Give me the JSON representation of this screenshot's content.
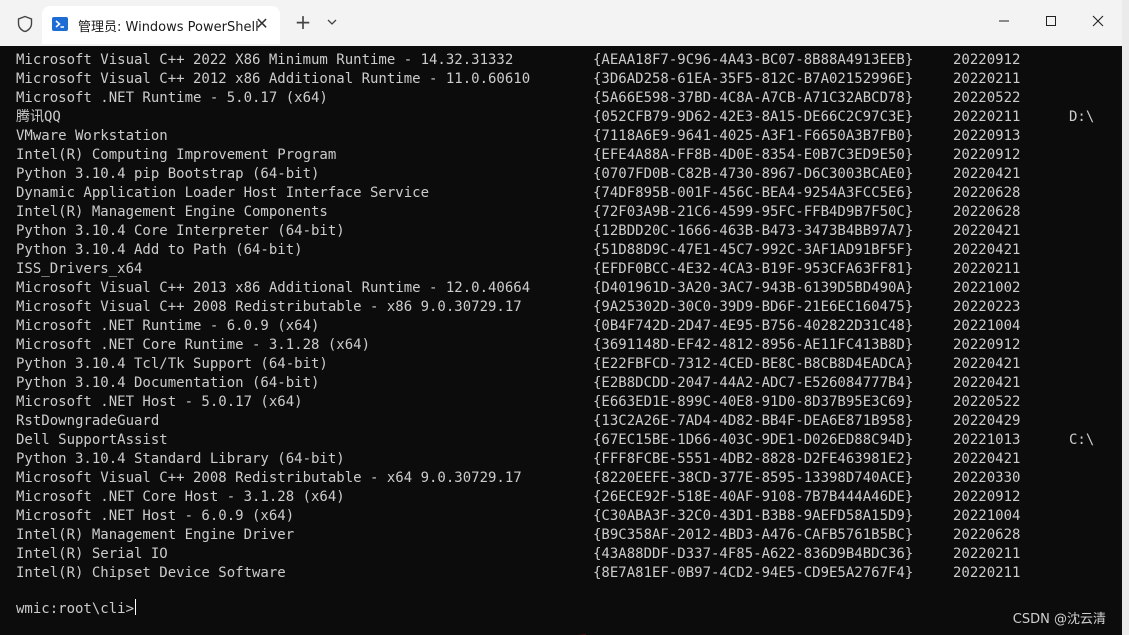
{
  "window": {
    "tab_title": "管理员: Windows PowerShell",
    "close_tab_glyph": "✕",
    "new_tab_glyph": "+",
    "controls": [
      "minimize-icon",
      "maximize-icon",
      "close-icon"
    ]
  },
  "terminal": {
    "rows": [
      {
        "name": "Microsoft Visual C++ 2022 X86 Minimum Runtime - 14.32.31332",
        "guid": "{AEAA18F7-9C96-4A43-BC07-8B88A4913EEB}",
        "date": "20220912",
        "loc": ""
      },
      {
        "name": "Microsoft Visual C++ 2012 x86 Additional Runtime - 11.0.60610",
        "guid": "{3D6AD258-61EA-35F5-812C-B7A02152996E}",
        "date": "20220211",
        "loc": ""
      },
      {
        "name": "Microsoft .NET Runtime - 5.0.17 (x64)",
        "guid": "{5A66E598-37BD-4C8A-A7CB-A71C32ABCD78}",
        "date": "20220522",
        "loc": ""
      },
      {
        "name": "腾讯QQ",
        "guid": "{052CFB79-9D62-42E3-8A15-DE66C2C97C3E}",
        "date": "20220211",
        "loc": "D:\\"
      },
      {
        "name": "VMware Workstation",
        "guid": "{7118A6E9-9641-4025-A3F1-F6650A3B7FB0}",
        "date": "20220913",
        "loc": ""
      },
      {
        "name": "Intel(R) Computing Improvement Program",
        "guid": "{EFE4A88A-FF8B-4D0E-8354-E0B7C3ED9E50}",
        "date": "20220912",
        "loc": ""
      },
      {
        "name": "Python 3.10.4 pip Bootstrap (64-bit)",
        "guid": "{0707FD0B-C82B-4730-8967-D6C3003BCAE0}",
        "date": "20220421",
        "loc": ""
      },
      {
        "name": "Dynamic Application Loader Host Interface Service",
        "guid": "{74DF895B-001F-456C-BEA4-9254A3FCC5E6}",
        "date": "20220628",
        "loc": ""
      },
      {
        "name": "Intel(R) Management Engine Components",
        "guid": "{72F03A9B-21C6-4599-95FC-FFB4D9B7F50C}",
        "date": "20220628",
        "loc": ""
      },
      {
        "name": "Python 3.10.4 Core Interpreter (64-bit)",
        "guid": "{12BDD20C-1666-463B-B473-3473B4BB97A7}",
        "date": "20220421",
        "loc": ""
      },
      {
        "name": "Python 3.10.4 Add to Path (64-bit)",
        "guid": "{51D88D9C-47E1-45C7-992C-3AF1AD91BF5F}",
        "date": "20220421",
        "loc": ""
      },
      {
        "name": "ISS_Drivers_x64",
        "guid": "{EFDF0BCC-4E32-4CA3-B19F-953CFA63FF81}",
        "date": "20220211",
        "loc": ""
      },
      {
        "name": "Microsoft Visual C++ 2013 x86 Additional Runtime - 12.0.40664",
        "guid": "{D401961D-3A20-3AC7-943B-6139D5BD490A}",
        "date": "20221002",
        "loc": ""
      },
      {
        "name": "Microsoft Visual C++ 2008 Redistributable - x86 9.0.30729.17",
        "guid": "{9A25302D-30C0-39D9-BD6F-21E6EC160475}",
        "date": "20220223",
        "loc": ""
      },
      {
        "name": "Microsoft .NET Runtime - 6.0.9 (x64)",
        "guid": "{0B4F742D-2D47-4E95-B756-402822D31C48}",
        "date": "20221004",
        "loc": ""
      },
      {
        "name": "Microsoft .NET Core Runtime - 3.1.28 (x64)",
        "guid": "{3691148D-EF42-4812-8956-AE11FC413B8D}",
        "date": "20220912",
        "loc": ""
      },
      {
        "name": "Python 3.10.4 Tcl/Tk Support (64-bit)",
        "guid": "{E22FBFCD-7312-4CED-BE8C-B8CB8D4EADCA}",
        "date": "20220421",
        "loc": ""
      },
      {
        "name": "Python 3.10.4 Documentation (64-bit)",
        "guid": "{E2B8DCDD-2047-44A2-ADC7-E526084777B4}",
        "date": "20220421",
        "loc": ""
      },
      {
        "name": "Microsoft .NET Host - 5.0.17 (x64)",
        "guid": "{E663ED1E-899C-40E8-91D0-8D37B95E3C69}",
        "date": "20220522",
        "loc": ""
      },
      {
        "name": "RstDowngradeGuard",
        "guid": "{13C2A26E-7AD4-4D82-BB4F-DEA6E871B958}",
        "date": "20220429",
        "loc": ""
      },
      {
        "name": "Dell SupportAssist",
        "guid": "{67EC15BE-1D66-403C-9DE1-D026ED88C94D}",
        "date": "20221013",
        "loc": "C:\\"
      },
      {
        "name": "Python 3.10.4 Standard Library (64-bit)",
        "guid": "{FFF8FCBE-5551-4DB2-8828-D2FE463981E2}",
        "date": "20220421",
        "loc": ""
      },
      {
        "name": "Microsoft Visual C++ 2008 Redistributable - x64 9.0.30729.17",
        "guid": "{8220EEFE-38CD-377E-8595-13398D740ACE}",
        "date": "20220330",
        "loc": ""
      },
      {
        "name": "Microsoft .NET Core Host - 3.1.28 (x64)",
        "guid": "{26ECE92F-518E-40AF-9108-7B7B444A46DE}",
        "date": "20220912",
        "loc": ""
      },
      {
        "name": "Microsoft .NET Host - 6.0.9 (x64)",
        "guid": "{C30ABA3F-32C0-43D1-B3B8-9AEFD58A15D9}",
        "date": "20221004",
        "loc": ""
      },
      {
        "name": "Intel(R) Management Engine Driver",
        "guid": "{B9C358AF-2012-4BD3-A476-CAFB5761B5BC}",
        "date": "20220628",
        "loc": ""
      },
      {
        "name": "Intel(R) Serial IO",
        "guid": "{43A88DDF-D337-4F85-A622-836D9B4BDC36}",
        "date": "20220211",
        "loc": ""
      },
      {
        "name": "Intel(R) Chipset Device Software",
        "guid": "{8E7A81EF-0B97-4CD2-94E5-CD9E5A2767F4}",
        "date": "20220211",
        "loc": ""
      }
    ],
    "prompt": "wmic:root\\cli>",
    "annotation_color": "#e8221b"
  },
  "watermark": "CSDN @沈云清"
}
